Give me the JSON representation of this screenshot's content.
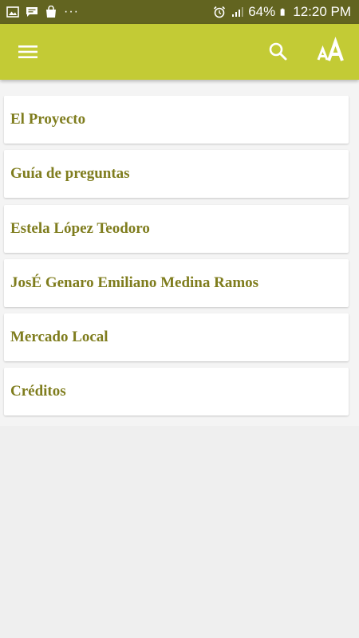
{
  "status_bar": {
    "battery": "64%",
    "time": "12:20 PM",
    "more": "···",
    "left_icons": [
      "image-icon",
      "message-icon",
      "shopping-bag-icon"
    ],
    "right_icons": [
      "alarm-icon",
      "signal-icon",
      "battery-icon"
    ]
  },
  "app_bar": {
    "icons": [
      "menu-icon",
      "search-icon",
      "font-size-icon"
    ],
    "color": "#c3cb35"
  },
  "list": {
    "items": [
      {
        "label": "El Proyecto"
      },
      {
        "label": "Guía de preguntas"
      },
      {
        "label": "Estela López Teodoro"
      },
      {
        "label": "JosÉ Genaro Emiliano Medina Ramos"
      },
      {
        "label": "Mercado Local"
      },
      {
        "label": "Créditos"
      }
    ],
    "text_color": "#7f7d1e"
  }
}
